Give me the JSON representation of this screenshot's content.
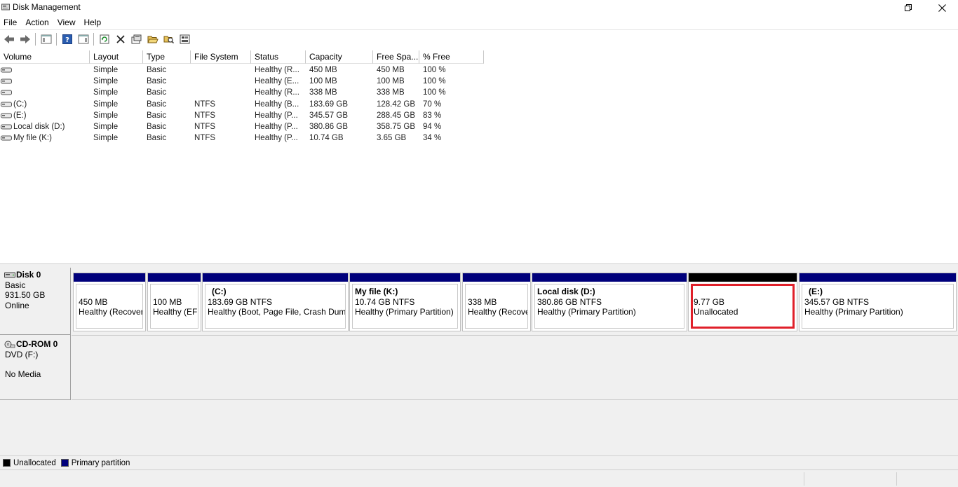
{
  "window": {
    "title": "Disk Management"
  },
  "menu": [
    "File",
    "Action",
    "View",
    "Help"
  ],
  "toolbar": {
    "buttons": [
      "back-icon",
      "forward-icon",
      "console-tree-icon",
      "help-icon",
      "properties-pane-icon",
      "refresh-icon",
      "delete-icon",
      "properties-icon",
      "open-icon",
      "explore-icon",
      "rescan-icon"
    ]
  },
  "volume_list": {
    "columns": [
      "Volume",
      "Layout",
      "Type",
      "File System",
      "Status",
      "Capacity",
      "Free Spa...",
      "% Free"
    ],
    "rows": [
      [
        "",
        "Simple",
        "Basic",
        "",
        "Healthy (R...",
        "450 MB",
        "450 MB",
        "100 %"
      ],
      [
        "",
        "Simple",
        "Basic",
        "",
        "Healthy (E...",
        "100 MB",
        "100 MB",
        "100 %"
      ],
      [
        "",
        "Simple",
        "Basic",
        "",
        "Healthy (R...",
        "338 MB",
        "338 MB",
        "100 %"
      ],
      [
        "(C:)",
        "Simple",
        "Basic",
        "NTFS",
        "Healthy (B...",
        "183.69 GB",
        "128.42 GB",
        "70 %"
      ],
      [
        "(E:)",
        "Simple",
        "Basic",
        "NTFS",
        "Healthy (P...",
        "345.57 GB",
        "288.45 GB",
        "83 %"
      ],
      [
        "Local disk (D:)",
        "Simple",
        "Basic",
        "NTFS",
        "Healthy (P...",
        "380.86 GB",
        "358.75 GB",
        "94 %"
      ],
      [
        "My file (K:)",
        "Simple",
        "Basic",
        "NTFS",
        "Healthy (P...",
        "10.74 GB",
        "3.65 GB",
        "34 %"
      ]
    ]
  },
  "disk0": {
    "name": "Disk 0",
    "type": "Basic",
    "size": "931.50 GB",
    "status": "Online",
    "partitions": [
      {
        "name": "",
        "size": "450 MB",
        "status": "Healthy (Recover",
        "kind": "primary"
      },
      {
        "name": "",
        "size": "100 MB",
        "status": "Healthy (EFI",
        "kind": "primary"
      },
      {
        "name": "(C:)",
        "size": "183.69 GB NTFS",
        "status": "Healthy (Boot, Page File, Crash Dump",
        "kind": "primary"
      },
      {
        "name": "My file  (K:)",
        "size": "10.74 GB NTFS",
        "status": "Healthy (Primary Partition)",
        "kind": "primary"
      },
      {
        "name": "",
        "size": "338 MB",
        "status": "Healthy (Recove",
        "kind": "primary"
      },
      {
        "name": "Local disk  (D:)",
        "size": "380.86 GB NTFS",
        "status": "Healthy (Primary Partition)",
        "kind": "primary"
      },
      {
        "name": "",
        "size": "9.77 GB",
        "status": "Unallocated",
        "kind": "unallocated",
        "highlighted": true
      },
      {
        "name": "(E:)",
        "size": "345.57 GB NTFS",
        "status": "Healthy (Primary Partition)",
        "kind": "primary"
      }
    ]
  },
  "cdrom0": {
    "name": "CD-ROM 0",
    "drive": "DVD (F:)",
    "media": "No Media"
  },
  "legend": [
    {
      "label": "Unallocated",
      "color": "#000000"
    },
    {
      "label": "Primary partition",
      "color": "#00007b"
    }
  ],
  "colors": {
    "primary_bar": "#00007b",
    "unallocated_bar": "#000000",
    "highlight_border": "#e0202a"
  }
}
